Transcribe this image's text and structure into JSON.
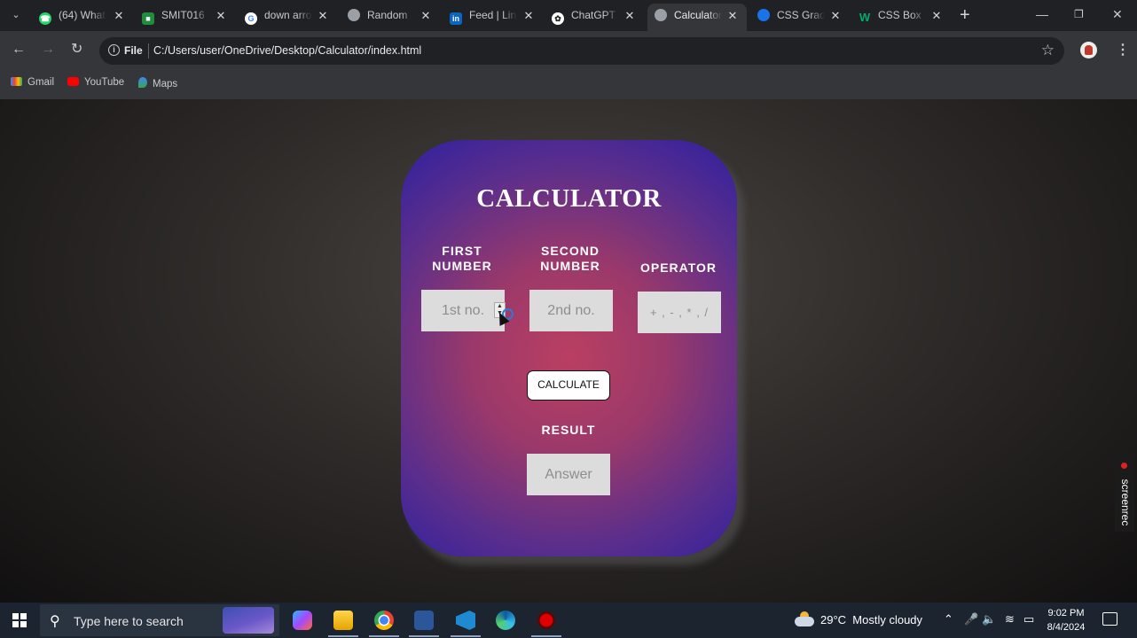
{
  "browser": {
    "tabs": [
      {
        "title": "(64) WhatsApp",
        "icon": "whatsapp-icon",
        "color": "#25d366"
      },
      {
        "title": "SMIT016",
        "icon": "classroom-icon",
        "color": "#1e8e3e"
      },
      {
        "title": "down arrow",
        "icon": "google-icon",
        "color": "#ffffff"
      },
      {
        "title": "Random",
        "icon": "globe-icon",
        "color": "#9aa0a6"
      },
      {
        "title": "Feed | LinkedIn",
        "icon": "linkedin-icon",
        "color": "#0a66c2"
      },
      {
        "title": "ChatGPT",
        "icon": "chatgpt-icon",
        "color": "#ffffff"
      },
      {
        "title": "Calculator",
        "icon": "globe-icon",
        "color": "#9aa0a6",
        "active": true
      },
      {
        "title": "CSS Gradient",
        "icon": "css-gradient-icon",
        "color": "#1a73e8"
      },
      {
        "title": "CSS Box Shadow",
        "icon": "w3schools-icon",
        "color": "#04aa6d"
      }
    ],
    "address_label": "File",
    "url": "C:/Users/user/OneDrive/Desktop/Calculator/index.html",
    "bookmarks": [
      {
        "label": "Gmail",
        "icon": "gmail-icon"
      },
      {
        "label": "YouTube",
        "icon": "youtube-icon"
      },
      {
        "label": "Maps",
        "icon": "maps-icon"
      }
    ]
  },
  "calculator": {
    "title": "CALCULATOR",
    "first_label": "FIRST NUMBER",
    "second_label": "SECOND NUMBER",
    "operator_label": "OPERATOR",
    "first_placeholder": "1st no.",
    "second_placeholder": "2nd no.",
    "operator_placeholder": "+ , - , * , /",
    "calculate_label": "CALCULATE",
    "result_label": "RESULT",
    "answer_placeholder": "Answer",
    "colors": {
      "center": "#ba3f62",
      "edge": "#2e1fa0"
    }
  },
  "overlay": {
    "screenrec_label": "screenrec"
  },
  "taskbar": {
    "search_placeholder": "Type here to search",
    "weather_temp": "29°C",
    "weather_desc": "Mostly cloudy",
    "time": "9:02 PM",
    "date": "8/4/2024"
  }
}
